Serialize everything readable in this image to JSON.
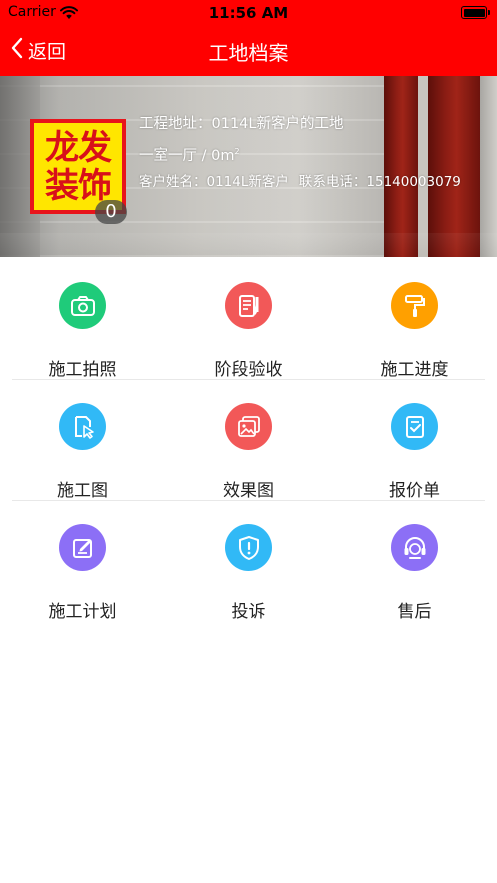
{
  "status_bar": {
    "carrier": "Carrier",
    "time": "11:56 AM",
    "wifi_icon": "wifi-icon",
    "battery_icon": "battery-icon"
  },
  "nav": {
    "back_label": "返回",
    "back_icon": "chevron-left-icon",
    "title": "工地档案"
  },
  "site": {
    "logo_lines": [
      "龙发",
      "装饰"
    ],
    "photo_count": "0",
    "address": "工程地址：0114L新客户的工地",
    "room": "一室一厅 / 0m",
    "room_unit_sup": "2",
    "customer": "客户姓名：0114L新客户",
    "phone": "联系电话：15140003079"
  },
  "menu": [
    {
      "label": "施工拍照",
      "icon": "camera-icon",
      "color": "#1fcb7a"
    },
    {
      "label": "阶段验收",
      "icon": "document-edit-icon",
      "color": "#f25858"
    },
    {
      "label": "施工进度",
      "icon": "paint-roller-icon",
      "color": "#ffa000"
    },
    {
      "label": "施工图",
      "icon": "blueprint-icon",
      "color": "#31b9f6"
    },
    {
      "label": "效果图",
      "icon": "gallery-icon",
      "color": "#f25858"
    },
    {
      "label": "报价单",
      "icon": "checklist-icon",
      "color": "#31b9f6"
    },
    {
      "label": "施工计划",
      "icon": "plan-edit-icon",
      "color": "#8c6ff6"
    },
    {
      "label": "投诉",
      "icon": "shield-alert-icon",
      "color": "#31b9f6"
    },
    {
      "label": "售后",
      "icon": "headset-icon",
      "color": "#8c6ff6"
    }
  ],
  "colors": {
    "brand_red": "#ff0000",
    "text": "#222222"
  }
}
